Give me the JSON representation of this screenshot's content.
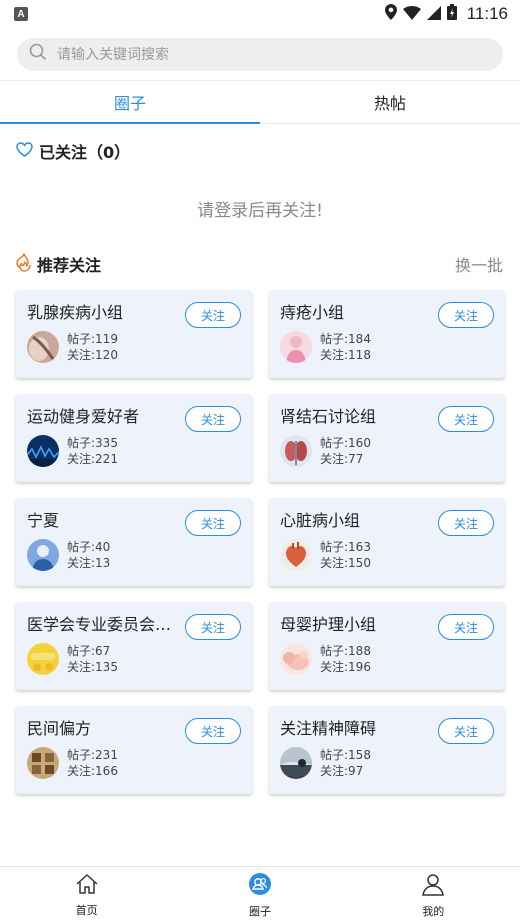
{
  "status_bar": {
    "time": "11:16",
    "app_badge": "A"
  },
  "search": {
    "placeholder": "请输入关键词搜索"
  },
  "tabs": [
    {
      "label": "圈子",
      "active": true
    },
    {
      "label": "热帖",
      "active": false
    }
  ],
  "followed": {
    "title": "已关注（0）",
    "login_hint": "请登录后再关注!"
  },
  "recommend": {
    "title": "推荐关注",
    "refresh_label": "换一批",
    "posts_prefix": "帖子:",
    "followers_prefix": "关注:",
    "follow_label": "关注",
    "groups": [
      {
        "name": "乳腺疾病小组",
        "posts": "119",
        "followers": "120"
      },
      {
        "name": "痔疮小组",
        "posts": "184",
        "followers": "118"
      },
      {
        "name": "运动健身爱好者",
        "posts": "335",
        "followers": "221"
      },
      {
        "name": "肾结石讨论组",
        "posts": "160",
        "followers": "77"
      },
      {
        "name": "宁夏",
        "posts": "40",
        "followers": "13"
      },
      {
        "name": "心脏病小组",
        "posts": "163",
        "followers": "150"
      },
      {
        "name": "医学会专业委员会…",
        "posts": "67",
        "followers": "135"
      },
      {
        "name": "母婴护理小组",
        "posts": "188",
        "followers": "196"
      },
      {
        "name": "民间偏方",
        "posts": "231",
        "followers": "166"
      },
      {
        "name": "关注精神障碍",
        "posts": "158",
        "followers": "97"
      }
    ]
  },
  "bottom_nav": [
    {
      "label": "首页",
      "icon": "home-icon"
    },
    {
      "label": "圈子",
      "icon": "circle-icon"
    },
    {
      "label": "我的",
      "icon": "user-icon"
    }
  ],
  "colors": {
    "accent": "#2b8de0",
    "card_bg": "#eef3fb",
    "hint": "#8a8a8a",
    "flame": "#f07a2a"
  }
}
